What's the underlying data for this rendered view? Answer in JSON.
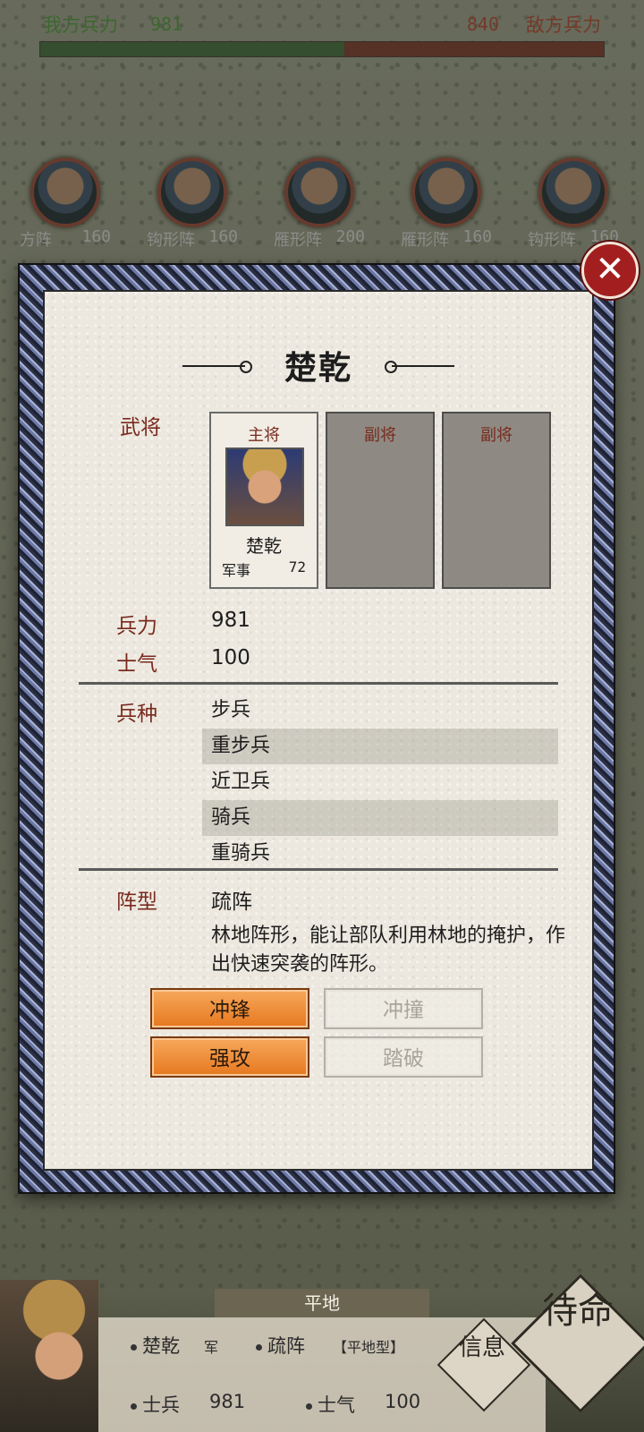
{
  "top_bar": {
    "ally_label": "我方兵力",
    "ally_count": "981",
    "enemy_label": "敌方兵力",
    "enemy_count": "840",
    "ally_share": 0.54,
    "ally_color": "#3f6e3a",
    "enemy_color": "#7a3a28"
  },
  "generals": [
    {
      "name": "方阵",
      "count": "160"
    },
    {
      "name": "钩形阵",
      "count": "160"
    },
    {
      "name": "雁形阵",
      "count": "200"
    },
    {
      "name": "雁形阵",
      "count": "160"
    },
    {
      "name": "钩形阵",
      "count": "160"
    }
  ],
  "modal": {
    "title": "楚乾",
    "close_icon": "close-icon",
    "general_label": "武将",
    "slots": {
      "main_head": "主将",
      "main_name": "楚乾",
      "main_stat_key": "军事",
      "main_stat_value": "72",
      "sub1_head": "副将",
      "sub2_head": "副将"
    },
    "troops_label": "兵力",
    "troops_value": "981",
    "morale_label": "士气",
    "morale_value": "100",
    "unit_type_label": "兵种",
    "unit_types": [
      "步兵",
      "重步兵",
      "近卫兵",
      "骑兵",
      "重骑兵"
    ],
    "formation_label": "阵型",
    "formation_value": "疏阵",
    "formation_desc": "林地阵形，能让部队利用林地的掩护，作出快速突袭的阵形。",
    "actions": [
      {
        "label": "冲锋",
        "enabled": true
      },
      {
        "label": "冲撞",
        "enabled": false
      },
      {
        "label": "强攻",
        "enabled": true
      },
      {
        "label": "踏破",
        "enabled": false
      }
    ]
  },
  "bottom": {
    "terrain": "平地",
    "general_name": "楚乾",
    "general_tag": "军",
    "formation": "疏阵",
    "formation_tag": "【平地型】",
    "soldiers_label": "士兵",
    "soldiers_value": "981",
    "morale_label": "士气",
    "morale_value": "100",
    "info_button": "信息",
    "standby_button": "待命"
  }
}
